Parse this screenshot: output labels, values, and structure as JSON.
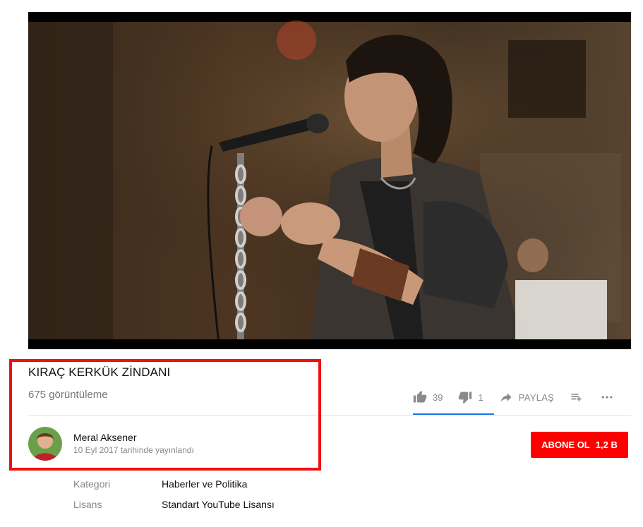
{
  "video": {
    "title": "KIRAÇ KERKÜK ZİNDANI",
    "views": "675 görüntüleme"
  },
  "actions": {
    "like_count": "39",
    "dislike_count": "1",
    "share_label": "PAYLAŞ",
    "like_icon": "thumb-up-icon",
    "dislike_icon": "thumb-down-icon",
    "share_icon": "share-arrow-icon",
    "playlist_icon": "add-to-playlist-icon",
    "more_icon": "more-horizontal-icon",
    "like_ratio": 0.975
  },
  "owner": {
    "channel_name": "Meral Aksener",
    "published": "10 Eyl 2017 tarihinde yayınlandı"
  },
  "subscribe": {
    "label": "ABONE OL",
    "count": "1,2 B"
  },
  "metadata": [
    {
      "key": "Kategori",
      "value": "Haberler ve Politika"
    },
    {
      "key": "Lisans",
      "value": "Standart YouTube Lisansı"
    }
  ],
  "colors": {
    "subscribe_bg": "#ff0000",
    "highlight_border": "#ee1111",
    "sentiment_bar": "#1a73e8"
  }
}
